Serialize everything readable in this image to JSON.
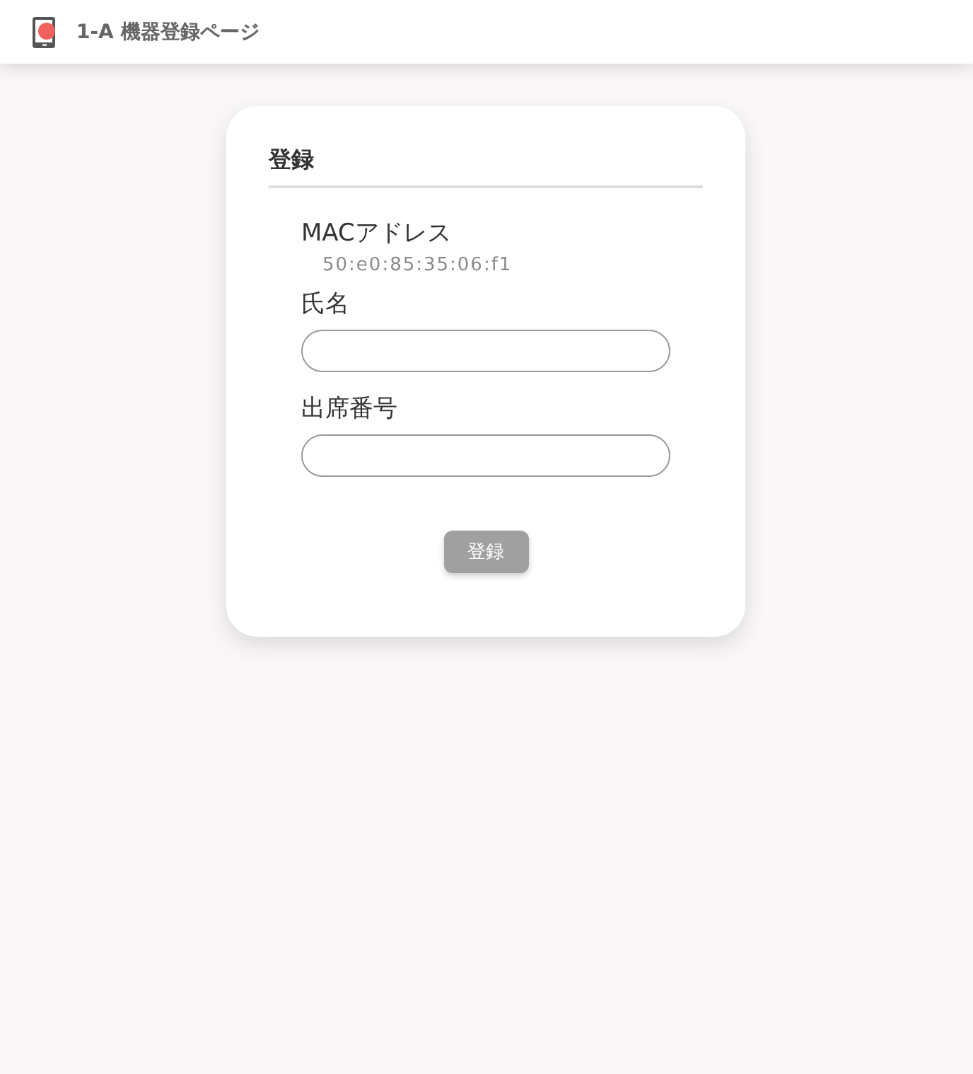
{
  "header": {
    "title": "1-A 機器登録ページ"
  },
  "card": {
    "title": "登録",
    "mac": {
      "label": "MACアドレス",
      "value": "50:e0:85:35:06:f1"
    },
    "fields": [
      {
        "label": "氏名"
      },
      {
        "label": "出席番号"
      }
    ],
    "submit": "登録"
  }
}
